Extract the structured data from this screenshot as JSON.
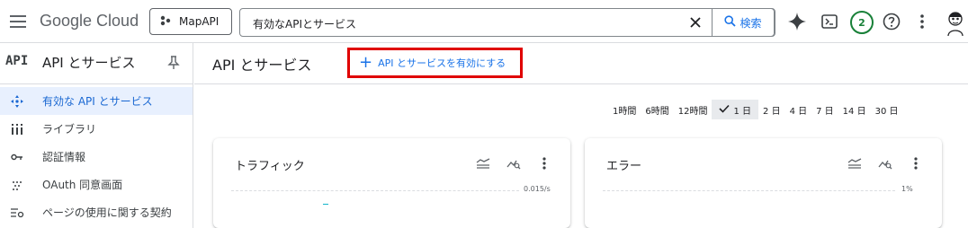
{
  "topbar": {
    "logo": "Google Cloud",
    "project": "MapAPI",
    "search_value": "有効なAPIとサービス",
    "search_button": "検索",
    "notifications_count": "2"
  },
  "sidebar": {
    "api_mark": "API",
    "title": "API とサービス",
    "items": [
      {
        "label": "有効な API とサービス",
        "icon": "hub-icon",
        "active": true
      },
      {
        "label": "ライブラリ",
        "icon": "library-icon"
      },
      {
        "label": "認証情報",
        "icon": "key-icon"
      },
      {
        "label": "OAuth 同意画面",
        "icon": "oauth-dots-icon"
      },
      {
        "label": "ページの使用に関する契約",
        "icon": "settings-list-icon"
      }
    ]
  },
  "main": {
    "title": "API とサービス",
    "enable_button": "API とサービスを有効にする",
    "ranges": [
      "1時間",
      "6時間",
      "12時間",
      "1 日",
      "2 日",
      "4 日",
      "7 日",
      "14 日",
      "30 日"
    ],
    "selected_range": "1 日",
    "cards": [
      {
        "title": "トラフィック",
        "scale": "0.015/s"
      },
      {
        "title": "エラー",
        "scale": "1%"
      }
    ]
  },
  "colors": {
    "accent": "#1a73e8",
    "highlight_border": "#e00000",
    "active_bg": "#e8f0fe",
    "badge_green": "#188038"
  }
}
